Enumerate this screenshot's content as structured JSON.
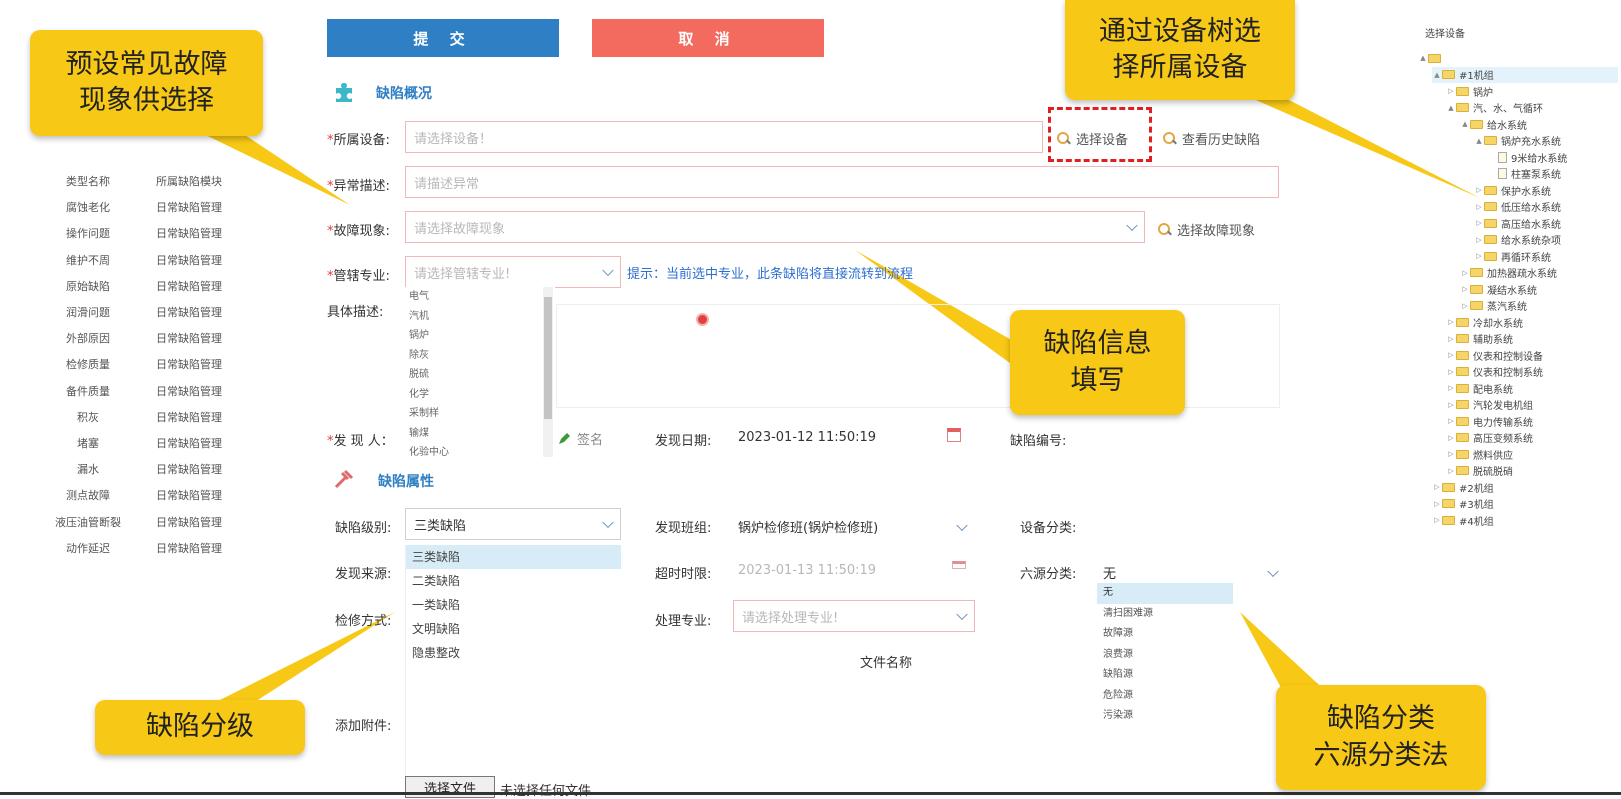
{
  "toolbar": {
    "submit_label": "提 交",
    "cancel_label": "取 消"
  },
  "sections": {
    "overview_title": "缺陷概况",
    "attributes_title": "缺陷属性"
  },
  "form": {
    "equipment": {
      "label": "所属设备:",
      "placeholder": "请选择设备！",
      "select_link": "选择设备",
      "history_link": "查看历史缺陷"
    },
    "abnormal": {
      "label": "异常描述:",
      "placeholder": "请描述异常"
    },
    "fault": {
      "label": "故障现象:",
      "placeholder": "请选择故障现象",
      "select_link": "选择故障现象"
    },
    "specialty": {
      "label": "管辖专业:",
      "placeholder": "请选择管辖专业!",
      "hint": "提示：当前选中专业，此条缺陷将直接流转到流程",
      "options": [
        "电气",
        "汽机",
        "锅炉",
        "除灰",
        "脱硫",
        "化学",
        "采制样",
        "输煤",
        "化验中心"
      ]
    },
    "detail": {
      "label": "具体描述:"
    },
    "finder": {
      "label": "发 现 人：",
      "sign": "签名"
    },
    "find_date": {
      "label": "发现日期:",
      "value": "2023-01-12 11:50:19"
    },
    "defect_no": {
      "label": "缺陷编号:"
    },
    "level": {
      "label": "缺陷级别:",
      "value": "三类缺陷",
      "options": [
        "三类缺陷",
        "二类缺陷",
        "一类缺陷",
        "文明缺陷",
        "隐患整改"
      ]
    },
    "team": {
      "label": "发现班组:",
      "value": "锅炉检修班(锅炉检修班)"
    },
    "equip_class": {
      "label": "设备分类:"
    },
    "source": {
      "label": "发现来源:"
    },
    "timeout": {
      "label": "超时时限:",
      "value": "2023-01-13 11:50:19"
    },
    "six_source": {
      "label": "六源分类:",
      "value": "无",
      "options": [
        "无",
        "清扫困难源",
        "故障源",
        "浪费源",
        "缺陷源",
        "危险源",
        "污染源"
      ]
    },
    "repair": {
      "label": "检修方式:"
    },
    "handle": {
      "label": "处理专业:",
      "placeholder": "请选择处理专业!"
    },
    "file_name_header": "文件名称",
    "attach": {
      "label": "添加附件:",
      "choose_button": "选择文件",
      "no_file": "未选择任何文件"
    }
  },
  "left_table": {
    "headers": [
      "类型名称",
      "所属缺陷模块"
    ],
    "rows": [
      [
        "腐蚀老化",
        "日常缺陷管理"
      ],
      [
        "操作问题",
        "日常缺陷管理"
      ],
      [
        "维护不周",
        "日常缺陷管理"
      ],
      [
        "原始缺陷",
        "日常缺陷管理"
      ],
      [
        "润滑问题",
        "日常缺陷管理"
      ],
      [
        "外部原因",
        "日常缺陷管理"
      ],
      [
        "检修质量",
        "日常缺陷管理"
      ],
      [
        "备件质量",
        "日常缺陷管理"
      ],
      [
        "积灰",
        "日常缺陷管理"
      ],
      [
        "堵塞",
        "日常缺陷管理"
      ],
      [
        "漏水",
        "日常缺陷管理"
      ],
      [
        "测点故障",
        "日常缺陷管理"
      ],
      [
        "液压油管断裂",
        "日常缺陷管理"
      ],
      [
        "动作延迟",
        "日常缺陷管理"
      ]
    ]
  },
  "tree": {
    "title": "选择设备",
    "nodes": [
      {
        "label": "",
        "depth": 0,
        "arrow": "▲",
        "icon": "folder"
      },
      {
        "label": "#1机组",
        "depth": 1,
        "arrow": "▲",
        "icon": "folder",
        "selected": true
      },
      {
        "label": "锅炉",
        "depth": 2,
        "arrow": "▷",
        "icon": "folder"
      },
      {
        "label": "汽、水、气循环",
        "depth": 2,
        "arrow": "▲",
        "icon": "folder"
      },
      {
        "label": "给水系统",
        "depth": 3,
        "arrow": "▲",
        "icon": "folder"
      },
      {
        "label": "锅炉充水系统",
        "depth": 4,
        "arrow": "▲",
        "icon": "folder"
      },
      {
        "label": "9米给水系统",
        "depth": 5,
        "arrow": "",
        "icon": "doc"
      },
      {
        "label": "柱塞泵系统",
        "depth": 5,
        "arrow": "",
        "icon": "doc"
      },
      {
        "label": "保护水系统",
        "depth": 4,
        "arrow": "▷",
        "icon": "folder"
      },
      {
        "label": "低压给水系统",
        "depth": 4,
        "arrow": "▷",
        "icon": "folder"
      },
      {
        "label": "高压给水系统",
        "depth": 4,
        "arrow": "▷",
        "icon": "folder"
      },
      {
        "label": "给水系统杂项",
        "depth": 4,
        "arrow": "▷",
        "icon": "folder"
      },
      {
        "label": "再循环系统",
        "depth": 4,
        "arrow": "▷",
        "icon": "folder"
      },
      {
        "label": "加热器疏水系统",
        "depth": 3,
        "arrow": "▷",
        "icon": "folder"
      },
      {
        "label": "凝结水系统",
        "depth": 3,
        "arrow": "▷",
        "icon": "folder"
      },
      {
        "label": "蒸汽系统",
        "depth": 3,
        "arrow": "▷",
        "icon": "folder"
      },
      {
        "label": "冷却水系统",
        "depth": 2,
        "arrow": "▷",
        "icon": "folder"
      },
      {
        "label": "辅助系统",
        "depth": 2,
        "arrow": "▷",
        "icon": "folder"
      },
      {
        "label": "仪表和控制设备",
        "depth": 2,
        "arrow": "▷",
        "icon": "folder"
      },
      {
        "label": "仪表和控制系统",
        "depth": 2,
        "arrow": "▷",
        "icon": "folder"
      },
      {
        "label": "配电系统",
        "depth": 2,
        "arrow": "▷",
        "icon": "folder"
      },
      {
        "label": "汽轮发电机组",
        "depth": 2,
        "arrow": "▷",
        "icon": "folder"
      },
      {
        "label": "电力传输系统",
        "depth": 2,
        "arrow": "▷",
        "icon": "folder"
      },
      {
        "label": "高压变频系统",
        "depth": 2,
        "arrow": "▷",
        "icon": "folder"
      },
      {
        "label": "燃料供应",
        "depth": 2,
        "arrow": "▷",
        "icon": "folder"
      },
      {
        "label": "脱硫脱硝",
        "depth": 2,
        "arrow": "▷",
        "icon": "folder"
      },
      {
        "label": "#2机组",
        "depth": 1,
        "arrow": "▷",
        "icon": "folder"
      },
      {
        "label": "#3机组",
        "depth": 1,
        "arrow": "▷",
        "icon": "folder"
      },
      {
        "label": "#4机组",
        "depth": 1,
        "arrow": "▷",
        "icon": "folder"
      }
    ]
  },
  "callouts": {
    "fault_preset": "预设常见故障\n现象供选择",
    "tree_select": "通过设备树选\n择所属设备",
    "info_fill": "缺陷信息\n填写",
    "grading": "缺陷分级",
    "six_source": "缺陷分类\n六源分类法"
  },
  "colors": {
    "primary": "#2f7fc4",
    "danger": "#f26b5e",
    "callout": "#f7c815",
    "required": "#e03b3b"
  }
}
